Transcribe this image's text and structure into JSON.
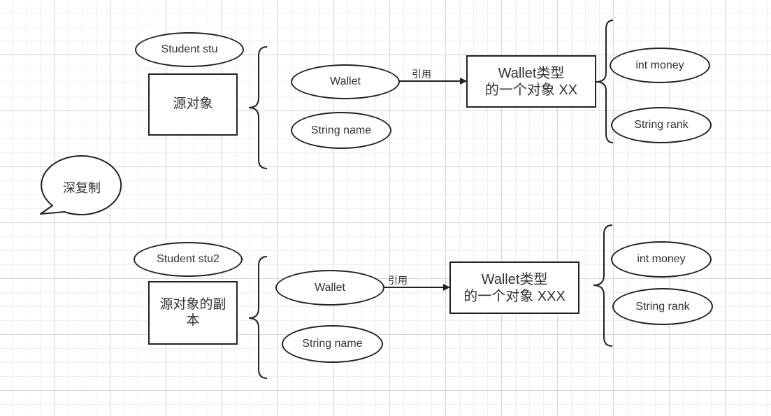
{
  "bubble": {
    "label": "深复制"
  },
  "top": {
    "variable": "Student stu",
    "object": "源对象",
    "fields": {
      "wallet": "Wallet",
      "name": "String name"
    },
    "edge_label": "引用",
    "target": {
      "line1": "Wallet类型",
      "line2": "的一个对象 XX"
    },
    "target_fields": {
      "money": "int money",
      "rank": "String rank"
    }
  },
  "bottom": {
    "variable": "Student stu2",
    "object_line1": "源对象的副",
    "object_line2": "本",
    "fields": {
      "wallet": "Wallet",
      "name": "String name"
    },
    "edge_label": "引用",
    "target": {
      "line1": "Wallet类型",
      "line2": "的一个对象 XXX"
    },
    "target_fields": {
      "money": "int money",
      "rank": "String rank"
    }
  }
}
